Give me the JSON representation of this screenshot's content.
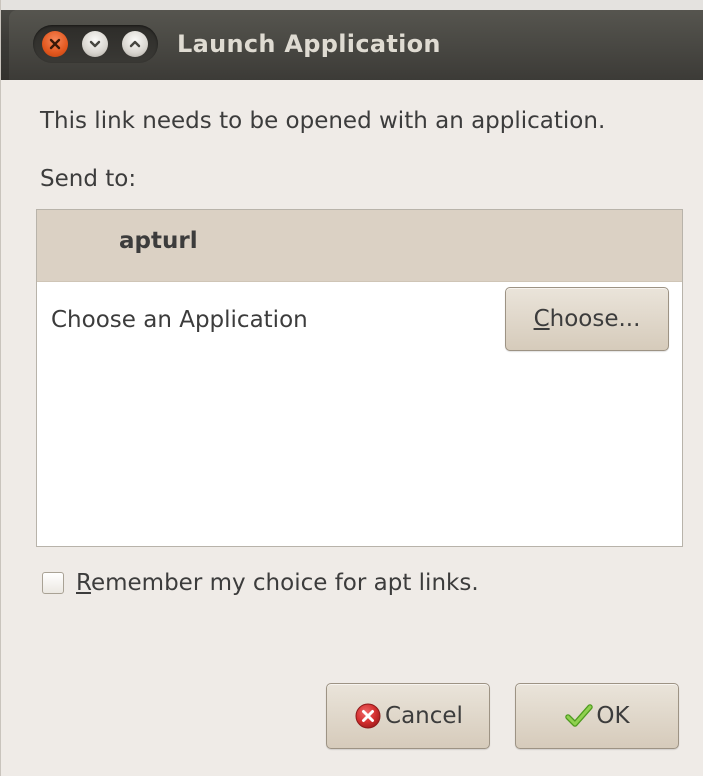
{
  "window": {
    "title": "Launch Application"
  },
  "dialog": {
    "message": "This link needs to be opened with an application.",
    "send_to_label": "Send to:",
    "list": {
      "header": "apturl",
      "row_label": "Choose an Application",
      "choose_button": {
        "mnemonic": "C",
        "rest": "hoose..."
      }
    },
    "remember_checkbox": {
      "checked": false,
      "mnemonic": "R",
      "rest": "emember my choice for apt links."
    },
    "buttons": {
      "cancel_label": "Cancel",
      "ok_label": "OK"
    }
  },
  "icons": {
    "close": "close-icon",
    "minimize": "minimize-icon",
    "maximize": "maximize-icon",
    "cancel": "cancel-icon",
    "ok": "checkmark-icon"
  },
  "colors": {
    "titlebar": "#3c3b37",
    "title_text": "#dfdbd2",
    "close_button": "#e2571e",
    "list_header": "#dbd1c4",
    "background": "#efebe7",
    "cancel_icon": "#d32f2f",
    "ok_icon": "#6cbf2a"
  }
}
